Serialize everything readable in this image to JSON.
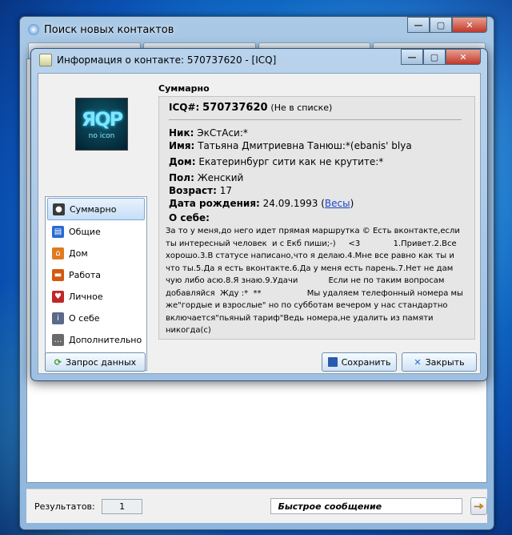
{
  "back_window": {
    "title": "Поиск новых контактов"
  },
  "status": {
    "results_label": "Результатов:",
    "results_count": "1",
    "quick_message": "Быстрое сообщение"
  },
  "dialog": {
    "title": "Информация о контакте:  570737620 - [ICQ]",
    "avatar": {
      "label": "no icon"
    },
    "nav": [
      {
        "label": "Суммарно",
        "icon": "person-icon",
        "color": "#3a3a3a"
      },
      {
        "label": "Общие",
        "icon": "card-icon",
        "color": "#2a6bd0"
      },
      {
        "label": "Дом",
        "icon": "house-icon",
        "color": "#e07a20"
      },
      {
        "label": "Работа",
        "icon": "briefcase-icon",
        "color": "#d45a10"
      },
      {
        "label": "Личное",
        "icon": "heart-icon",
        "color": "#c02828"
      },
      {
        "label": "О себе",
        "icon": "info-icon",
        "color": "#5a6a8a"
      },
      {
        "label": "Дополнительно",
        "icon": "more-icon",
        "color": "#6a6a6a"
      }
    ],
    "buttons": {
      "request": "Запрос данных",
      "save": "Сохранить",
      "close": "Закрыть"
    },
    "summary": {
      "header": "Суммарно",
      "icq_label": "ICQ#:",
      "icq_number": "570737620",
      "icq_note": "(Не в списке)",
      "nick_label": "Ник:",
      "nick": "ЭкСтАси:*",
      "name_label": "Имя:",
      "name": "Татьяна Дмитриевна Танюш:*(ebanis' blya",
      "home_label": "Дом:",
      "home": "Екатеринбург сити как не крутите:*",
      "gender_label": "Пол:",
      "gender": "Женский",
      "age_label": "Возраст:",
      "age": "17",
      "dob_label": "Дата рождения:",
      "dob": "24.09.1993",
      "dob_link": "Весы",
      "about_label": "О себе:",
      "about": "За то у меня,до него идет прямая маршрутка © Есть вконтакте,если ты интересный человек  и с Екб пиши;-)     <3             1.Привет.2.Все хорошо.3.В статусе написано,что я делаю.4.Мне все равно как ты и что ты.5.Да я есть вконтакте.6.Да у меня есть парень.7.Нет не дам чую либо асю.8.Я знаю.9.Удачи            Если не по таким вопросам добавляйся  Жду :*  **                  Мы удаляем телефонный номера мы же\"гордые и взрослые\" но по субботам вечером у нас стандартно  включается\"пьяный тариф\"Ведь номера,не удалить из памяти никогда(с)"
    }
  }
}
